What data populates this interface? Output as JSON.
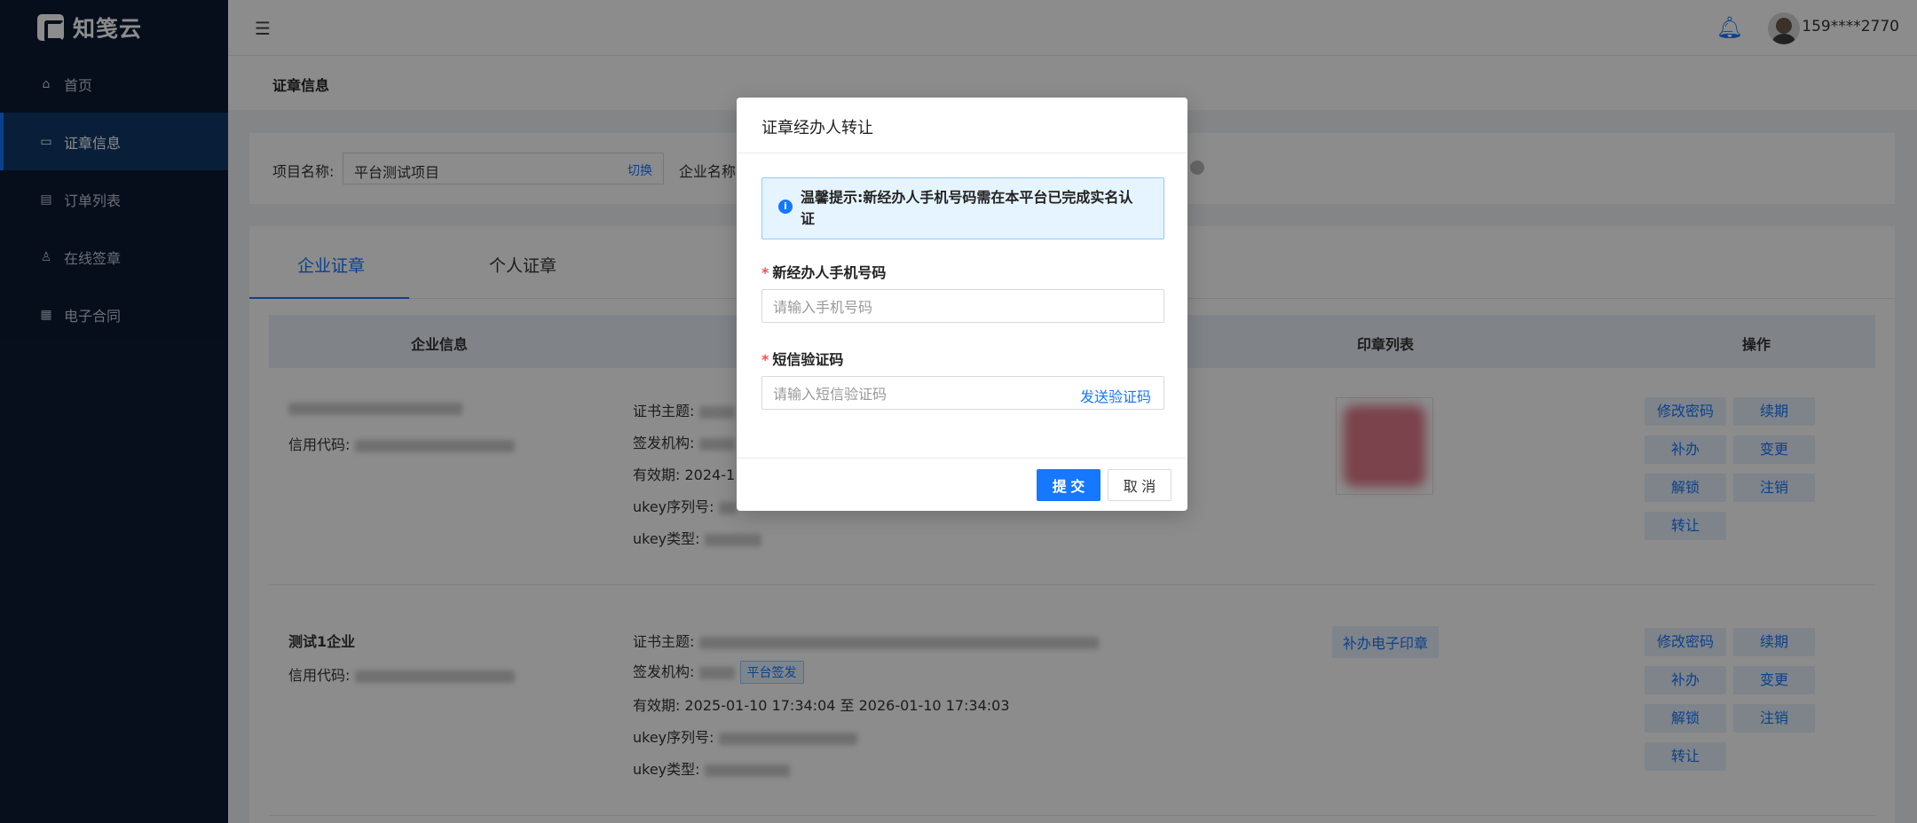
{
  "app": {
    "logo_text": "知笺云"
  },
  "sidebar": {
    "items": [
      {
        "label": "首页",
        "icon": "home-icon"
      },
      {
        "label": "证章信息",
        "icon": "card-icon"
      },
      {
        "label": "订单列表",
        "icon": "list-icon"
      },
      {
        "label": "在线签章",
        "icon": "user-icon"
      },
      {
        "label": "电子合同",
        "icon": "doc-icon"
      }
    ],
    "active": 1
  },
  "header": {
    "user_phone": "159****2770"
  },
  "breadcrumb": {
    "title": "证章信息"
  },
  "filter": {
    "project_label": "项目名称:",
    "project_value": "平台测试项目",
    "switch_label": "切换",
    "company_label": "企业名称"
  },
  "tabs": [
    "企业证章",
    "个人证章"
  ],
  "table": {
    "headers": [
      "企业信息",
      "印章列表",
      "操作"
    ],
    "rows": [
      {
        "company_name": "",
        "credit_label": "信用代码:",
        "cert_subject_label": "证书主题:",
        "issuer_label": "签发机构:",
        "validity_label": "有效期:",
        "validity_value": "2024-1",
        "ukey_serial_label": "ukey序列号:",
        "ukey_type_label": "ukey类型:",
        "ops": [
          "修改密码",
          "续期",
          "补办",
          "变更",
          "解锁",
          "注销",
          "转让"
        ]
      },
      {
        "company_name": "测试1企业",
        "credit_label": "信用代码:",
        "cert_subject_label": "证书主题:",
        "issuer_label": "签发机构:",
        "issuer_tag": "平台签发",
        "validity_label": "有效期:",
        "validity_value": "2025-01-10 17:34:04 至 2026-01-10 17:34:03",
        "ukey_serial_label": "ukey序列号:",
        "ukey_type_label": "ukey类型:",
        "seal_action": "补办电子印章",
        "ops": [
          "修改密码",
          "续期",
          "补办",
          "变更",
          "解锁",
          "注销",
          "转让"
        ]
      }
    ]
  },
  "modal": {
    "title": "证章经办人转让",
    "alert": "温馨提示:新经办人手机号码需在本平台已完成实名认证",
    "phone_label": "新经办人手机号码",
    "phone_placeholder": "请输入手机号码",
    "sms_label": "短信验证码",
    "sms_placeholder": "请输入短信验证码",
    "send_code": "发送验证码",
    "submit": "提 交",
    "cancel": "取 消"
  },
  "colors": {
    "primary": "#1677ff",
    "sidebar_bg": "#0c1a33",
    "required": "#ff4d4f"
  }
}
